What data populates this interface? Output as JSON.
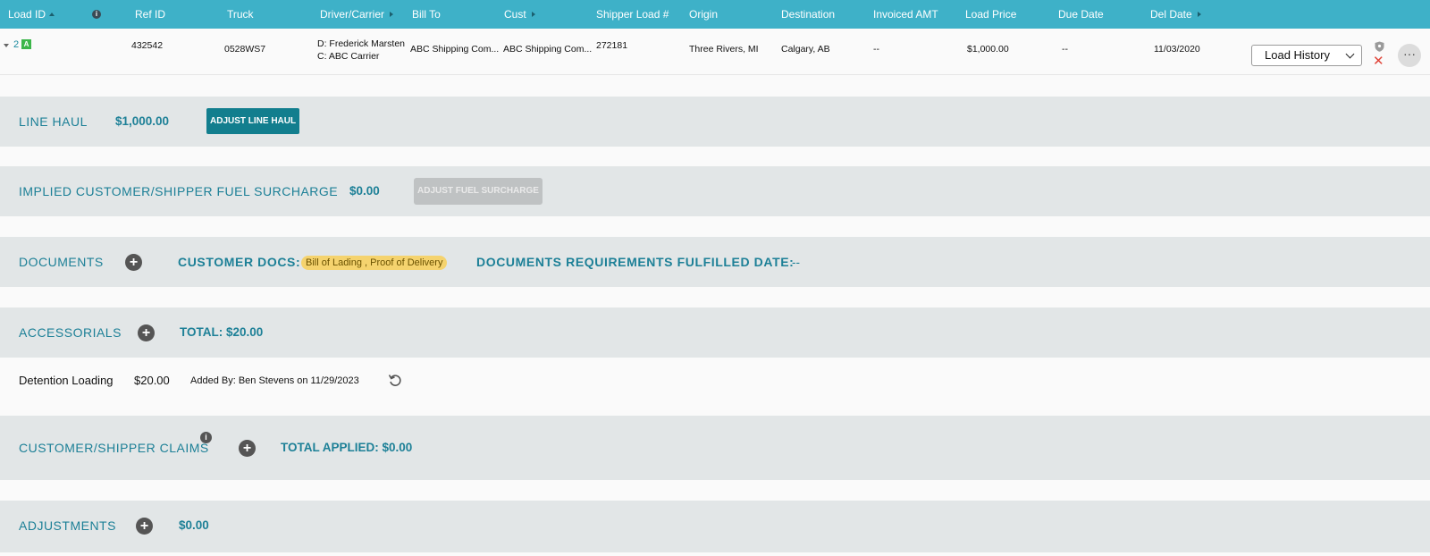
{
  "header": {
    "load_id": "Load ID",
    "ref_id": "Ref ID",
    "truck": "Truck",
    "driver_carrier": "Driver/Carrier",
    "bill_to": "Bill To",
    "cust": "Cust",
    "shipper_load": "Shipper Load #",
    "origin": "Origin",
    "destination": "Destination",
    "invoiced_amt": "Invoiced AMT",
    "load_price": "Load Price",
    "due_date": "Due Date",
    "del_date": "Del Date"
  },
  "row": {
    "load_num": "2",
    "badge": "A",
    "ref_id": "432542",
    "truck": "0528WS7",
    "driver": "D: Frederick Marsten",
    "carrier": "C: ABC Carrier",
    "bill_to": "ABC Shipping Com...",
    "cust": "ABC Shipping Com...",
    "shipper_load": "272181",
    "origin": "Three Rivers, MI",
    "destination": "Calgary, AB",
    "invoiced_amt": "--",
    "load_price": "$1,000.00",
    "due_date": "--",
    "del_date": "11/03/2020",
    "history_select": "Load History"
  },
  "line_haul": {
    "title": "LINE HAUL",
    "amount": "$1,000.00",
    "button": "ADJUST LINE HAUL"
  },
  "fuel": {
    "title": "IMPLIED CUSTOMER/SHIPPER FUEL SURCHARGE",
    "amount": "$0.00",
    "button": "ADJUST FUEL SURCHARGE"
  },
  "documents": {
    "title": "DOCUMENTS",
    "customer_docs_label": "CUSTOMER DOCS:",
    "customer_docs_value": "Bill of Lading , Proof of Delivery",
    "fulfilled_label": "DOCUMENTS REQUIREMENTS FULFILLED DATE:",
    "fulfilled_value": "--"
  },
  "accessorials": {
    "title": "ACCESSORIALS",
    "total": "TOTAL: $20.00",
    "items": [
      {
        "name": "Detention Loading",
        "amount": "$20.00",
        "added_by": "Added By: Ben Stevens on 11/29/2023"
      }
    ]
  },
  "claims": {
    "title": "CUSTOMER/SHIPPER CLAIMS",
    "total": "TOTAL APPLIED: $0.00"
  },
  "adjustments": {
    "title": "ADJUSTMENTS",
    "amount": "$0.00"
  },
  "colors": {
    "header_bg": "#3eb1c8",
    "accent": "#1d8097",
    "button_bg": "#127e8e",
    "band_bg": "#e2e6e7",
    "pill_bg": "#f5d36e",
    "badge_green": "#3cb64a",
    "delete_red": "#e0453a"
  }
}
